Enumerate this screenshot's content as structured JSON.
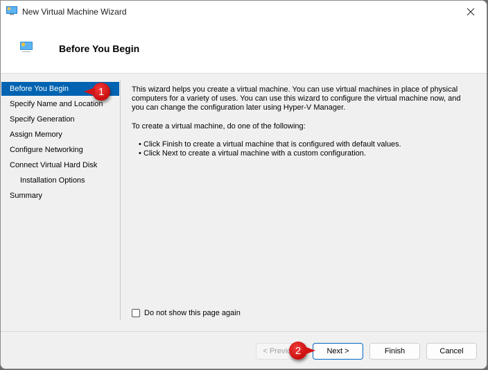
{
  "window": {
    "title": "New Virtual Machine Wizard",
    "app_icon": "monitor-icon",
    "close_icon": "close-icon"
  },
  "header": {
    "icon": "monitor-icon",
    "title": "Before You Begin"
  },
  "sidebar": {
    "items": [
      {
        "label": "Before You Begin",
        "active": true
      },
      {
        "label": "Specify Name and Location"
      },
      {
        "label": "Specify Generation"
      },
      {
        "label": "Assign Memory"
      },
      {
        "label": "Configure Networking"
      },
      {
        "label": "Connect Virtual Hard Disk"
      },
      {
        "label": "Installation Options",
        "indent": true
      },
      {
        "label": "Summary"
      }
    ]
  },
  "content": {
    "paragraph1": "This wizard helps you create a virtual machine. You can use virtual machines in place of physical computers for a variety of uses. You can use this wizard to configure the virtual machine now, and you can change the configuration later using Hyper-V Manager.",
    "paragraph2": "To create a virtual machine, do one of the following:",
    "bullets": [
      "Click Finish to create a virtual machine that is configured with default values.",
      "Click Next to create a virtual machine with a custom configuration."
    ],
    "checkbox_label": "Do not show this page again",
    "checkbox_checked": false
  },
  "buttons": {
    "previous": "< Previous",
    "next": "Next >",
    "finish": "Finish",
    "cancel": "Cancel"
  },
  "annotations": {
    "callout1": "1",
    "callout2": "2",
    "color": "#d41515"
  },
  "colors": {
    "accent": "#0063b1",
    "window_bg": "#f0f0f0"
  }
}
